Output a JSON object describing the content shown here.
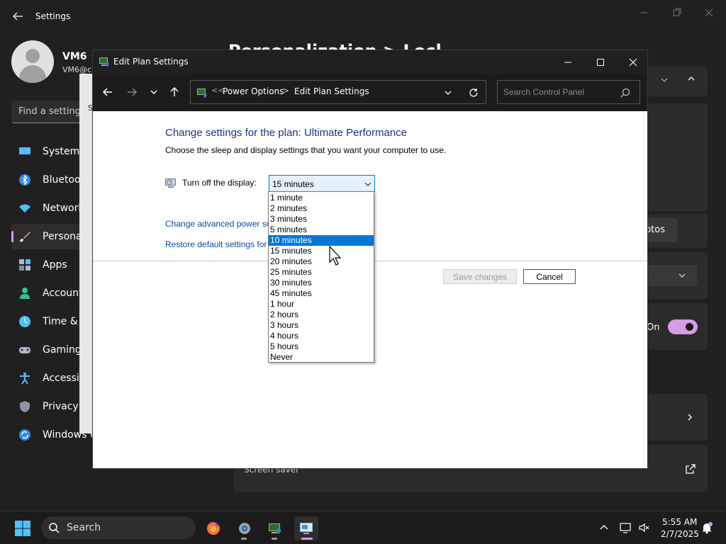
{
  "settings": {
    "title": "Settings",
    "user": {
      "name": "VM6",
      "email": "VM6@c"
    },
    "search_placeholder": "Find a setting",
    "page_heading": "Personalization > Lock",
    "nav": [
      {
        "label": "System",
        "icon": "monitor-icon",
        "active": false
      },
      {
        "label": "Bluetooth",
        "icon": "bluetooth-icon",
        "active": false
      },
      {
        "label": "Network",
        "icon": "wifi-icon",
        "active": false
      },
      {
        "label": "Personal",
        "icon": "brush-icon",
        "active": true
      },
      {
        "label": "Apps",
        "icon": "apps-icon",
        "active": false
      },
      {
        "label": "Accounts",
        "icon": "person-icon",
        "active": false
      },
      {
        "label": "Time &",
        "icon": "clock-icon",
        "active": false
      },
      {
        "label": "Gaming",
        "icon": "gamepad-icon",
        "active": false
      },
      {
        "label": "Accessib",
        "icon": "accessibility-icon",
        "active": false
      },
      {
        "label": "Privacy &",
        "icon": "shield-icon",
        "active": false
      },
      {
        "label": "Windows U",
        "icon": "update-icon",
        "active": false
      }
    ],
    "photos_label": "otos",
    "toggle_label": "On",
    "screen_saver_label": "Screen saver",
    "legacy_letter": "S"
  },
  "cp": {
    "title": "Edit Plan Settings",
    "breadcrumb": [
      "Power Options",
      "Edit Plan Settings"
    ],
    "breadcrumb_prefix": "<<",
    "breadcrumb_sep": ">",
    "search_placeholder": "Search Control Panel",
    "heading": "Change settings for the plan: Ultimate Performance",
    "subheading": "Choose the sleep and display settings that you want your computer to use.",
    "display_label": "Turn off the display:",
    "display_value": "15 minutes",
    "link_advanced": "Change advanced power se",
    "link_restore": "Restore default settings for",
    "save_label": "Save changes",
    "cancel_label": "Cancel"
  },
  "dropdown": {
    "options": [
      "1 minute",
      "2 minutes",
      "3 minutes",
      "5 minutes",
      "10 minutes",
      "15 minutes",
      "20 minutes",
      "25 minutes",
      "30 minutes",
      "45 minutes",
      "1 hour",
      "2 hours",
      "3 hours",
      "4 hours",
      "5 hours",
      "Never"
    ],
    "highlighted_index": 4
  },
  "taskbar": {
    "search_label": "Search",
    "time": "5:55 AM",
    "date": "2/7/2025",
    "apps": [
      "firefox-icon",
      "settings-gear-icon",
      "control-panel-icon",
      "remote-desktop-icon"
    ]
  },
  "colors": {
    "accent": "#0078d7",
    "settings_accent": "#d59ee6",
    "heading_blue": "#1e3287",
    "link_blue": "#0b4a9b"
  }
}
